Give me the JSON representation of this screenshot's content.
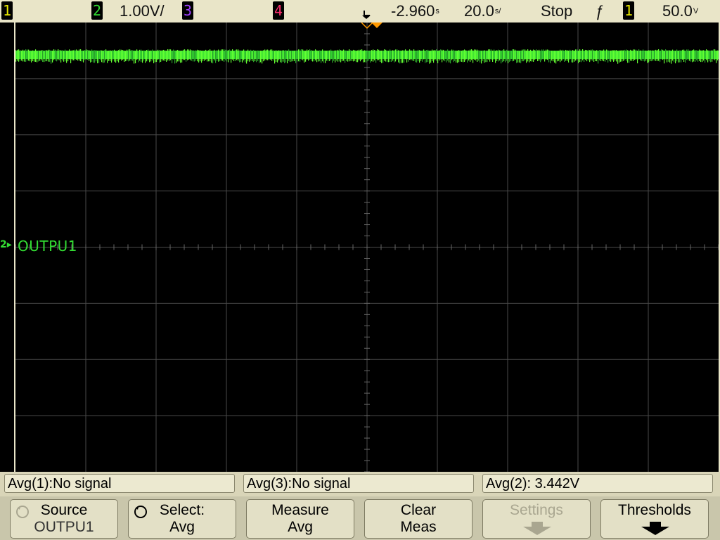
{
  "top_bar": {
    "ch1_box": "1",
    "ch2_box": "2",
    "ch2_scale": "1.00V/",
    "ch3_box": "3",
    "ch4_box": "4",
    "delay": "-2.960",
    "delay_unit": "s",
    "timebase": "20.0",
    "timebase_unit": "s/",
    "run_state": "Stop",
    "trigger_slope_symbol": "ƒ",
    "trigger_source_box": "1",
    "trigger_level": "50.0",
    "trigger_level_unit": "V"
  },
  "screen": {
    "ch2_label": "OUTPU1",
    "ch2_ground_marker": "2"
  },
  "measurements": [
    {
      "text": "Avg(1):No signal"
    },
    {
      "text": "Avg(3):No signal"
    },
    {
      "text": "Avg(2): 3.442V"
    }
  ],
  "softkeys": {
    "source": {
      "line1": "Source",
      "line2": "OUTPU1"
    },
    "select": {
      "line1": "Select:",
      "line2": "Avg"
    },
    "measure": {
      "line1": "Measure",
      "line2": "Avg"
    },
    "clear": {
      "line1": "Clear",
      "line2": "Meas"
    },
    "settings": {
      "line1": "Settings"
    },
    "thresholds": {
      "line1": "Thresholds"
    }
  },
  "colors": {
    "ch1": "#e8e800",
    "ch2": "#33dd33",
    "ch3": "#a040ff",
    "ch4": "#ff3070",
    "trigger": "#ff9900",
    "grid": "#4a4a4a"
  },
  "icons": {
    "delay_marker": "trigger-delay-arrow-icon",
    "trigger_slope": "rising-edge-icon",
    "source_rotate": "rotate-knob-icon",
    "select_rotate": "rotate-knob-icon",
    "settings_arrow": "down-arrow-icon",
    "thresholds_arrow": "down-arrow-icon"
  }
}
